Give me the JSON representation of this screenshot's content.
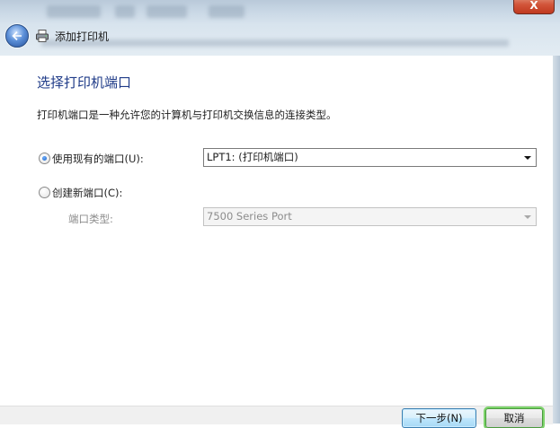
{
  "window": {
    "title": "添加打印机",
    "close_glyph": "X"
  },
  "page": {
    "heading": "选择打印机端口",
    "description": "打印机端口是一种允许您的计算机与打印机交换信息的连接类型。"
  },
  "options": {
    "existing": {
      "label": "使用现有的端口(U):",
      "selected": true,
      "value": "LPT1: (打印机端口)"
    },
    "new": {
      "label": "创建新端口(C):",
      "selected": false,
      "type_label": "端口类型:",
      "type_value": "7500 Series Port"
    }
  },
  "buttons": {
    "next": "下一步(N)",
    "cancel": "取消"
  },
  "colors": {
    "heading": "#1f3b88",
    "close_button": "#c0391f"
  }
}
